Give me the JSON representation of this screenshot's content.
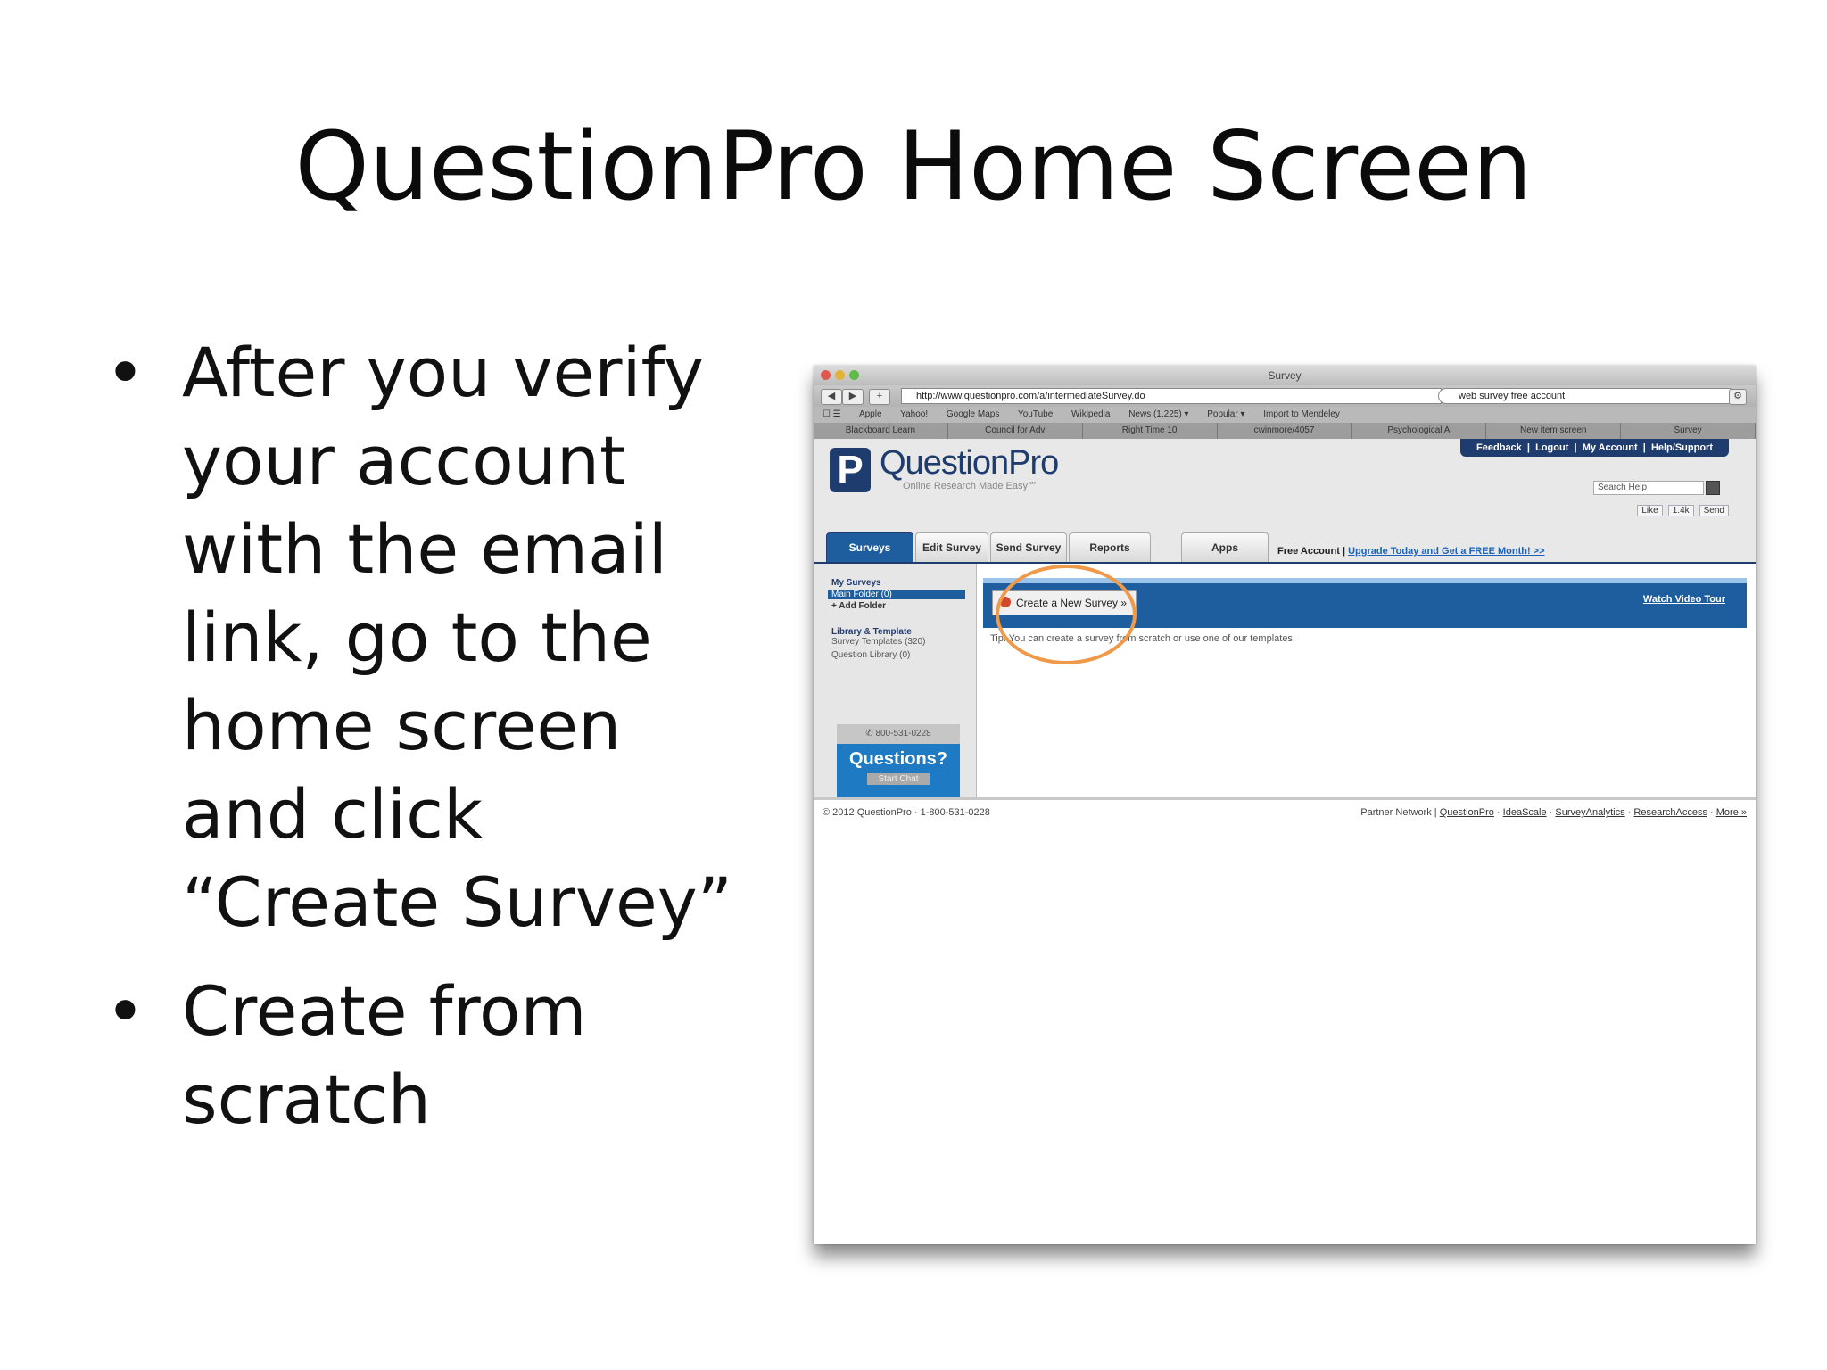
{
  "slide": {
    "title": "QuestionPro Home Screen",
    "bullets": [
      "After you verify your account with the email link, go to the home screen and click “Create Survey”",
      "Create from scratch"
    ]
  },
  "browser": {
    "window_title": "Survey",
    "url": "http://www.questionpro.com/a/intermediateSurvey.do",
    "search_value": "web survey free account",
    "bookmarks": [
      "Apple",
      "Yahoo!",
      "Google Maps",
      "YouTube",
      "Wikipedia",
      "News (1,225) ▾",
      "Popular ▾",
      "Import to Mendeley"
    ],
    "tabs": [
      "Blackboard Learn",
      "Council for Adv",
      "Right Time 10",
      "cwinmore/4057",
      "Psychological A",
      "New item screen",
      "Survey"
    ]
  },
  "app": {
    "top_links": [
      "Feedback",
      "Logout",
      "My Account",
      "Help/Support"
    ],
    "logo_name": "QuestionPro",
    "logo_tagline": "Online Research Made Easy℠",
    "search_placeholder": "Search Help",
    "social": [
      "Like",
      "1.4k",
      "Send"
    ],
    "nav_tabs": [
      "Surveys",
      "Edit Survey",
      "Send Survey",
      "Reports",
      "Apps"
    ],
    "account_label": "Free Account",
    "upgrade_link": "Upgrade Today and Get a FREE Month! >>",
    "sidebar": {
      "my_surveys": "My Surveys",
      "main_folder": "Main Folder (0)",
      "add_folder": "+ Add Folder",
      "library_heading": "Library & Template",
      "survey_templates": "Survey Templates (320)",
      "question_library": "Question Library (0)",
      "phone": "800-531-0228",
      "questions": "Questions?",
      "start_chat": "Start Chat"
    },
    "create_button": "Create a New Survey »",
    "video_tour": "Watch Video Tour",
    "tip": "Tip: You can create a survey from scratch or use one of our templates.",
    "footer_left": "© 2012 QuestionPro · 1-800-531-0228",
    "footer_links": [
      "Partner Network",
      "QuestionPro",
      "IdeaScale",
      "SurveyAnalytics",
      "ResearchAccess",
      "More »"
    ]
  },
  "colors": {
    "brand_navy": "#1f3c6e",
    "brand_blue": "#1f5e9e",
    "highlight_circle": "#ef9a4a"
  }
}
